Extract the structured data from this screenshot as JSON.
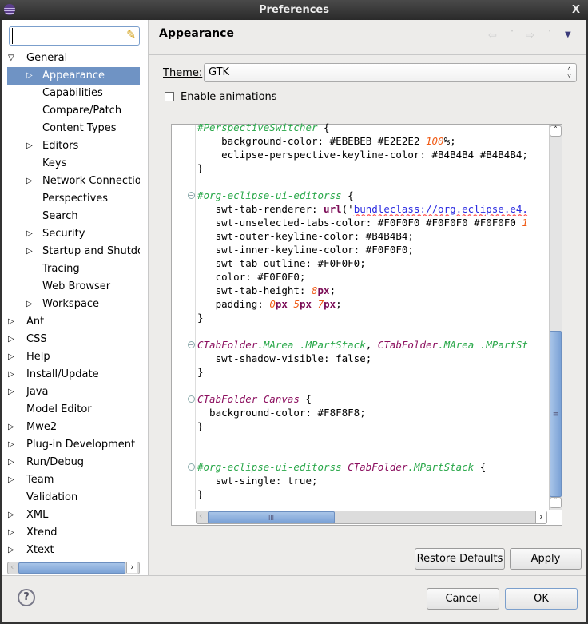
{
  "window": {
    "title": "Preferences",
    "close": "X"
  },
  "search": {
    "value": "",
    "placeholder": ""
  },
  "tree": [
    {
      "label": "General",
      "level": 0,
      "twisty": "open"
    },
    {
      "label": "Appearance",
      "level": 1,
      "twisty": "closed",
      "selected": true
    },
    {
      "label": "Capabilities",
      "level": 1
    },
    {
      "label": "Compare/Patch",
      "level": 1
    },
    {
      "label": "Content Types",
      "level": 1
    },
    {
      "label": "Editors",
      "level": 1,
      "twisty": "closed"
    },
    {
      "label": "Keys",
      "level": 1
    },
    {
      "label": "Network Connection",
      "level": 1,
      "twisty": "closed"
    },
    {
      "label": "Perspectives",
      "level": 1
    },
    {
      "label": "Search",
      "level": 1
    },
    {
      "label": "Security",
      "level": 1,
      "twisty": "closed"
    },
    {
      "label": "Startup and Shutdow",
      "level": 1,
      "twisty": "closed"
    },
    {
      "label": "Tracing",
      "level": 1
    },
    {
      "label": "Web Browser",
      "level": 1
    },
    {
      "label": "Workspace",
      "level": 1,
      "twisty": "closed"
    },
    {
      "label": "Ant",
      "level": 0,
      "twisty": "closed"
    },
    {
      "label": "CSS",
      "level": 0,
      "twisty": "closed"
    },
    {
      "label": "Help",
      "level": 0,
      "twisty": "closed"
    },
    {
      "label": "Install/Update",
      "level": 0,
      "twisty": "closed"
    },
    {
      "label": "Java",
      "level": 0,
      "twisty": "closed"
    },
    {
      "label": "Model Editor",
      "level": 0
    },
    {
      "label": "Mwe2",
      "level": 0,
      "twisty": "closed"
    },
    {
      "label": "Plug-in Development",
      "level": 0,
      "twisty": "closed"
    },
    {
      "label": "Run/Debug",
      "level": 0,
      "twisty": "closed"
    },
    {
      "label": "Team",
      "level": 0,
      "twisty": "closed"
    },
    {
      "label": "Validation",
      "level": 0
    },
    {
      "label": "XML",
      "level": 0,
      "twisty": "closed"
    },
    {
      "label": "Xtend",
      "level": 0,
      "twisty": "closed"
    },
    {
      "label": "Xtext",
      "level": 0,
      "twisty": "closed"
    }
  ],
  "page": {
    "title": "Appearance",
    "theme_label": "Theme:",
    "theme_value": "GTK",
    "animations_label": "Enable animations",
    "animations_checked": false
  },
  "code_lines": [
    [
      [
        "#PerspectiveSwitcher",
        "g"
      ],
      [
        " {",
        ""
      ]
    ],
    [
      [
        "    background-color: #EBEBEB #E2E2E2 ",
        ""
      ],
      [
        "100",
        "n"
      ],
      [
        "%;",
        ""
      ]
    ],
    [
      [
        "    eclipse-perspective-keyline-color: #B4B4B4 #B4B4B4;",
        ""
      ]
    ],
    [
      [
        "}",
        ""
      ]
    ],
    [],
    [
      [
        "#org-eclipse-ui-editorss",
        "g"
      ],
      [
        " {",
        ""
      ]
    ],
    [
      [
        "   swt-tab-renderer: ",
        ""
      ],
      [
        "url",
        "k"
      ],
      [
        "('",
        ""
      ],
      [
        "bundleclass://org.eclipse.e4.",
        "s"
      ]
    ],
    [
      [
        "   swt-unselected-tabs-color: #F0F0F0 #F0F0F0 #F0F0F0 ",
        ""
      ],
      [
        "1",
        "n"
      ]
    ],
    [
      [
        "   swt-outer-keyline-color: #B4B4B4;",
        ""
      ]
    ],
    [
      [
        "   swt-inner-keyline-color: #F0F0F0;",
        ""
      ]
    ],
    [
      [
        "   swt-tab-outline: #F0F0F0;",
        ""
      ]
    ],
    [
      [
        "   color: #F0F0F0;",
        ""
      ]
    ],
    [
      [
        "   swt-tab-height: ",
        ""
      ],
      [
        "8",
        "n"
      ],
      [
        "px",
        "k"
      ],
      [
        ";",
        ""
      ]
    ],
    [
      [
        "   padding: ",
        ""
      ],
      [
        "0",
        "n"
      ],
      [
        "px",
        "k"
      ],
      [
        " ",
        ""
      ],
      [
        "5",
        "n"
      ],
      [
        "px",
        "k"
      ],
      [
        " ",
        ""
      ],
      [
        "7",
        "n"
      ],
      [
        "px",
        "k"
      ],
      [
        ";",
        ""
      ]
    ],
    [
      [
        "}",
        ""
      ]
    ],
    [],
    [
      [
        "CTabFolder",
        "m"
      ],
      [
        ".MArea .MPartStack",
        "g"
      ],
      [
        ", ",
        ""
      ],
      [
        "CTabFolder",
        "m"
      ],
      [
        ".MArea .MPartSt",
        "g"
      ]
    ],
    [
      [
        "   swt-shadow-visible: false;",
        ""
      ]
    ],
    [
      [
        "}",
        ""
      ]
    ],
    [],
    [
      [
        "CTabFolder Canvas",
        "m"
      ],
      [
        " {",
        ""
      ]
    ],
    [
      [
        "  background-color: #F8F8F8;",
        ""
      ]
    ],
    [
      [
        "}",
        ""
      ]
    ],
    [],
    [],
    [
      [
        "#org-eclipse-ui-editorss",
        "g"
      ],
      [
        " ",
        ""
      ],
      [
        "CTabFolder",
        "m"
      ],
      [
        ".MPartStack",
        "g"
      ],
      [
        " {",
        ""
      ]
    ],
    [
      [
        "   swt-single: true;",
        ""
      ]
    ],
    [
      [
        "}",
        ""
      ]
    ]
  ],
  "buttons": {
    "restore": "Restore Defaults",
    "apply": "Apply",
    "cancel": "Cancel",
    "ok": "OK"
  },
  "colors": {
    "selection": "#6f93c4",
    "selector": "#2aa84a",
    "type": "#8b0e5e",
    "number": "#f05a14",
    "string": "#2a2ae0"
  }
}
